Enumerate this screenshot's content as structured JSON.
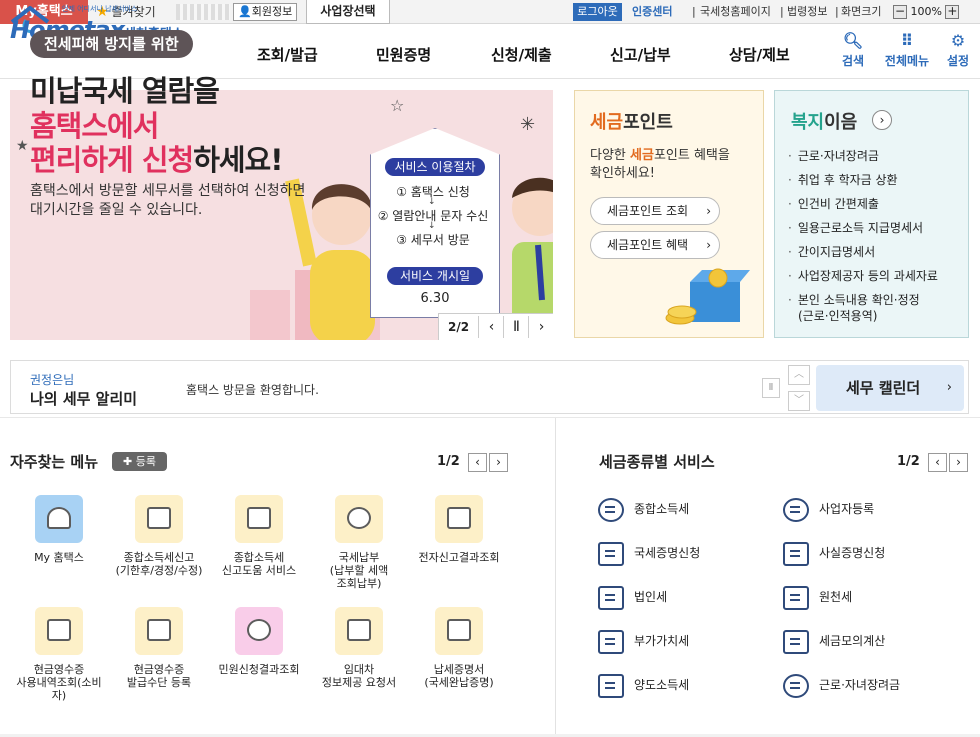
{
  "topbar": {
    "myhome": "My홈택스",
    "favorites": "즐겨찾기",
    "member_info": "회원정보",
    "biz_select": "사업장선택",
    "logout": "로그아웃",
    "cert_center": "인증센터",
    "links": [
      "국세청홈페이지",
      "법령정보",
      "화면크기"
    ],
    "zoom": "100%"
  },
  "header": {
    "logo_tag": "언제 어디서나 납세서비스",
    "logo_text": "Hometax.",
    "logo_kr": "국세청홈택스",
    "nav": [
      "조회/발급",
      "민원증명",
      "신청/제출",
      "신고/납부",
      "상담/제보"
    ],
    "icons": [
      {
        "label": "검색",
        "icon": "search-icon"
      },
      {
        "label": "전체메뉴",
        "icon": "grid-icon"
      },
      {
        "label": "설정",
        "icon": "gear-icon"
      }
    ]
  },
  "banner": {
    "pill": "전세피해 방지를 위한",
    "line1": "미납국세 열람을",
    "line2": "홈택스에서",
    "line3_pink": "편리하게 신청",
    "line3_rest": "하세요!",
    "sub1": "홈택스에서 방문할 세무서를 선택하여 신청하면",
    "sub2": "대기시간을 줄일 수 있습니다.",
    "process_title": "서비스 이용절차",
    "steps": [
      "① 홈택스 신청",
      "② 열람안내 문자 수신",
      "③ 세무서 방문"
    ],
    "start_label": "서비스 개시일",
    "start_date": "6.30",
    "page": "2/2"
  },
  "taxpoint": {
    "title_pre": "세금",
    "title_post": "포인트",
    "desc1_pre": "다양한 ",
    "desc1_hl": "세금",
    "desc1_post": "포인트 혜택을",
    "desc2": "확인하세요!",
    "btn1": "세금포인트 조회",
    "btn2": "세금포인트 혜택"
  },
  "welfare": {
    "title_pre": "복지",
    "title_post": "이음",
    "items": [
      "근로·자녀장려금",
      "취업 후 학자금 상환",
      "인건비 간편제출",
      "일용근로소득 지급명세서",
      "간이지급명세서",
      "사업장제공자 등의 과세자료",
      "본인 소득내용 확인·정정",
      "(근로·인적용역)"
    ]
  },
  "alarm": {
    "name": "권정은님",
    "title": "나의 세무 알리미",
    "message": "홈택스 방문을 환영합니다.",
    "calendar": "세무 캘린더"
  },
  "freq_menu": {
    "title": "자주찾는 메뉴",
    "register": "등록",
    "page": "1/2",
    "items": [
      [
        "My 홈택스"
      ],
      [
        "종합소득세신고",
        "(기한후/경정/수정)"
      ],
      [
        "종합소득세",
        "신고도움 서비스"
      ],
      [
        "국세납부",
        "(납부할 세액",
        "조회납부)"
      ],
      [
        "전자신고결과조회"
      ],
      [
        "현금영수증",
        "사용내역조회(소비",
        "자)"
      ],
      [
        "현금영수증",
        "발급수단 등록"
      ],
      [
        "민원신청결과조회"
      ],
      [
        "임대차",
        "정보제공 요청서"
      ],
      [
        "납세증명서",
        "(국세완납증명)"
      ]
    ]
  },
  "tax_types": {
    "title": "세금종류별 서비스",
    "page": "1/2",
    "items": [
      "종합소득세",
      "사업자등록",
      "국세증명신청",
      "사실증명신청",
      "법인세",
      "원천세",
      "부가가치세",
      "세금모의계산",
      "양도소득세",
      "근로·자녀장려금"
    ]
  },
  "colors": {
    "brand_blue": "#2d6bb9",
    "myhome_red": "#d9524a",
    "banner_pink": "#e0315e",
    "taxpoint_orange": "#e26b1f",
    "welfare_green": "#25a38d"
  }
}
